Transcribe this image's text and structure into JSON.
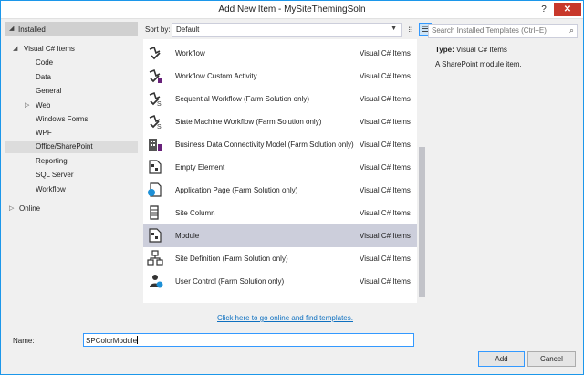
{
  "window": {
    "title": "Add New Item - MySiteThemingSoln",
    "help": "?",
    "close": "✕"
  },
  "left_panel": {
    "installed": "Installed",
    "tree": [
      {
        "label": "Visual C# Items",
        "expander": "◢"
      },
      {
        "label": "Code"
      },
      {
        "label": "Data"
      },
      {
        "label": "General"
      },
      {
        "label": "Web",
        "expander": "▷"
      },
      {
        "label": "Windows Forms"
      },
      {
        "label": "WPF"
      },
      {
        "label": "Office/SharePoint",
        "selected": true
      },
      {
        "label": "Reporting"
      },
      {
        "label": "SQL Server"
      },
      {
        "label": "Workflow"
      }
    ],
    "online": {
      "label": "Online",
      "expander": "▷"
    }
  },
  "toolbar": {
    "sort_label": "Sort by:",
    "sort_value": "Default",
    "dropdown_icon": "▼",
    "grid_view_icon": "⁞⁞",
    "list_view_icon": "☰"
  },
  "templates": [
    {
      "name": "Workflow",
      "category": "Visual C# Items",
      "icon": "workflow-icon"
    },
    {
      "name": "Workflow Custom Activity",
      "category": "Visual C# Items",
      "icon": "workflow-activity-icon"
    },
    {
      "name": "Sequential Workflow (Farm Solution only)",
      "category": "Visual C# Items",
      "icon": "sequential-workflow-icon"
    },
    {
      "name": "State Machine Workflow (Farm Solution only)",
      "category": "Visual C# Items",
      "icon": "state-machine-icon"
    },
    {
      "name": "Business Data Connectivity Model (Farm Solution only)",
      "category": "Visual C# Items",
      "icon": "bdc-model-icon"
    },
    {
      "name": "Empty Element",
      "category": "Visual C# Items",
      "icon": "empty-element-icon"
    },
    {
      "name": "Application Page (Farm Solution only)",
      "category": "Visual C# Items",
      "icon": "application-page-icon"
    },
    {
      "name": "Site Column",
      "category": "Visual C# Items",
      "icon": "site-column-icon"
    },
    {
      "name": "Module",
      "category": "Visual C# Items",
      "icon": "module-icon",
      "selected": true
    },
    {
      "name": "Site Definition (Farm Solution only)",
      "category": "Visual C# Items",
      "icon": "site-definition-icon"
    },
    {
      "name": "User Control (Farm Solution only)",
      "category": "Visual C# Items",
      "icon": "user-control-icon"
    }
  ],
  "online_link": "Click here to go online and find templates.",
  "search": {
    "placeholder": "Search Installed Templates (Ctrl+E)",
    "icon": "⌕"
  },
  "details": {
    "type_label": "Type:",
    "type_value": "Visual C# Items",
    "description": "A SharePoint module item."
  },
  "name_field": {
    "label": "Name:",
    "value": "SPColorModule"
  },
  "buttons": {
    "add": "Add",
    "cancel": "Cancel"
  },
  "colors": {
    "accent": "#3399ff",
    "selection": "#cccedb",
    "link": "#0e70c0",
    "close": "#c8382b"
  }
}
